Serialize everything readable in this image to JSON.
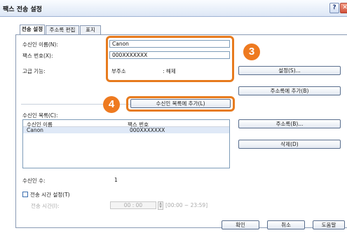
{
  "window": {
    "title": "팩스 전송 설정",
    "help_label": "?",
    "close_label": "✕"
  },
  "tabs": [
    {
      "label": "전송 설정",
      "active": true
    },
    {
      "label": "주소록 편집",
      "active": false
    },
    {
      "label": "표지",
      "active": false
    }
  ],
  "form": {
    "recipient_name_label": "수신인 이름(N):",
    "recipient_name_value": "Canon",
    "fax_number_label": "팩스 번호(X):",
    "fax_number_value": "000XXXXXXX",
    "advanced_label": "고급 기능:",
    "subaddress_label": "부주소",
    "subaddress_value": ": 해제"
  },
  "buttons": {
    "settings": "설정(S)...",
    "add_to_addressbook": "주소록에 추가(B)",
    "add_to_recipient_list": "수신인 목록에 추가(L)",
    "addressbook": "주소록(B)...",
    "delete": "삭제(D)",
    "ok": "확인",
    "cancel": "취소",
    "help": "도움말"
  },
  "recipient_list": {
    "label": "수신인 목록(C):",
    "columns": [
      "수신인 이름",
      "팩스 번호"
    ],
    "rows": [
      {
        "name": "Canon",
        "fax": "000XXXXXXX"
      }
    ],
    "count_label": "수신인 수:",
    "count_value": "1"
  },
  "send_time": {
    "checkbox_label": "전송 시간 설정(T)",
    "checked": false,
    "time_label": "전송 시간(I):",
    "time_value": "00 : 00",
    "range_hint": "[00:00 ~ 23:59]"
  },
  "annotations": {
    "step3": "3",
    "step4": "4",
    "accent_color": "#e77b1e"
  }
}
